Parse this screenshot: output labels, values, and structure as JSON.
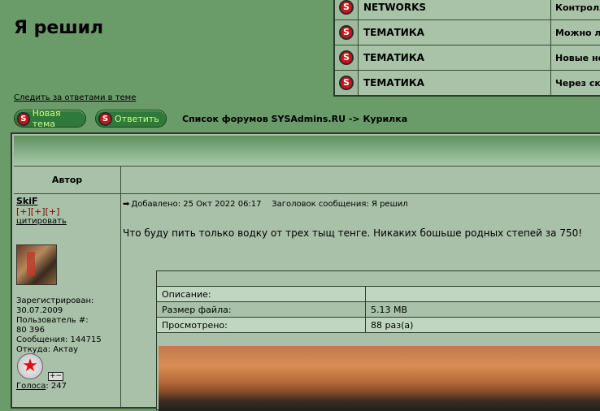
{
  "topic": {
    "title": "Я решил"
  },
  "news": {
    "rows": [
      {
        "category": "NETWORKS",
        "desc": "Контролле"
      },
      {
        "category": "ТЕМАТИКА",
        "desc": "Можно ли"
      },
      {
        "category": "ТЕМАТИКА",
        "desc": "Новые ноу"
      },
      {
        "category": "ТЕМАТИКА",
        "desc": "Через ско"
      }
    ]
  },
  "watch_link": "Следить за ответами в теме",
  "buttons": {
    "new_topic": "Новая тема",
    "reply": "Ответить",
    "icon_letter": "S"
  },
  "nav": {
    "path": "Список форумов SYSAdmins.RU -> Курилка"
  },
  "table": {
    "author_header": "Автор"
  },
  "author": {
    "name": "SkiF",
    "plus": "[+][+][+]",
    "quote": "цитировать",
    "registered": "Зарегистрирован:",
    "registered_date": "30.07.2009",
    "user_num_label": "Пользователь #:",
    "user_num": "80 396",
    "messages": "Сообщения: 144715",
    "from": "Откуда: Актау",
    "medal_glyph": "★",
    "plusminus": "+−",
    "votes_label": "Голоса",
    "votes_value": ": 247"
  },
  "post": {
    "arrow": "➡",
    "meta": "Добавлено: 25 Окт 2022 06:17    Заголовок сообщения: Я решил",
    "text": "Что буду пить только водку от трех тыщ тенге. Никаких бошьше родных степей за 750!"
  },
  "file": {
    "rows": [
      {
        "k": "Описание:",
        "v": ""
      },
      {
        "k": "Размер файла:",
        "v": "5.13 MB"
      },
      {
        "k": "Просмотрено:",
        "v": "88 раз(а)"
      }
    ]
  }
}
